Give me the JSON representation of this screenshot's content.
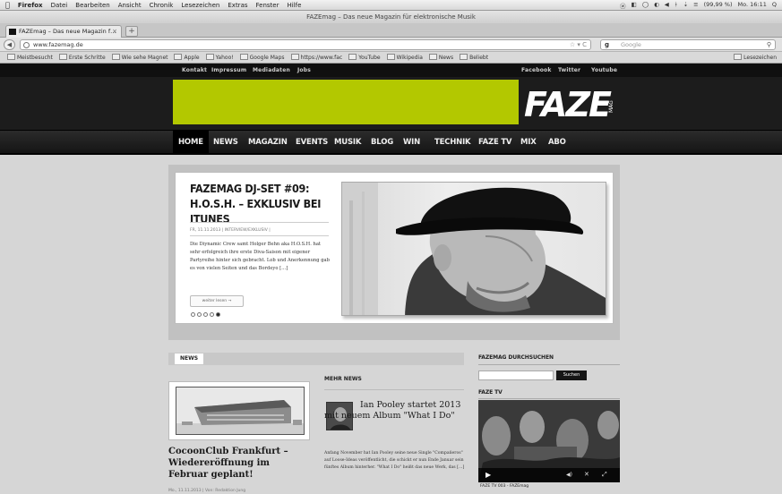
{
  "mac_menubar": {
    "apple_icon": "apple-icon",
    "menus": [
      "Firefox",
      "Datei",
      "Bearbeiten",
      "Ansicht",
      "Chronik",
      "Lesezeichen",
      "Extras",
      "Fenster",
      "Hilfe"
    ],
    "right_items": [
      "ⓦ",
      "◧",
      "◯",
      "◐",
      "◀",
      "ᚼ",
      "⇣",
      "≡",
      "(99,99 %)",
      "Mo. 16:11",
      "Q"
    ]
  },
  "browser": {
    "window_title": "FAZEmag – Das neue Magazin für elektronische Musik",
    "tab_label": "FAZEmag – Das neue Magazin f…",
    "new_tab_label": "+",
    "url": "www.fazemag.de",
    "search_engine": "Google",
    "search_placeholder": "Google",
    "bookmarks": [
      "Meistbesucht",
      "Erste Schritte",
      "Wie sehe Magnet",
      "Apple",
      "Yahoo!",
      "Google Maps",
      "https://www.fac",
      "YouTube",
      "Wikipedia",
      "News",
      "Beliebt"
    ],
    "bookmarks_right": "Lesezeichen"
  },
  "site": {
    "topstrip_left": [
      "Kontakt",
      "Impressum",
      "Mediadaten",
      "Jobs"
    ],
    "topstrip_right": [
      "Facebook",
      "Twitter",
      "Youtube"
    ],
    "banner_color": "#b3c800",
    "logo_text": "FAZE",
    "logo_small": "MAG",
    "nav": [
      "Home",
      "News",
      "Magazin",
      "Events",
      "Musik",
      "Blog",
      "Win",
      "Technik",
      "FAZE TV",
      "Mix",
      "Abo"
    ],
    "slider": {
      "title": "FAZEMAG DJ-SET #09: H.O.S.H. – EXKLUSIV BEI ITUNES",
      "meta": "FR, 11.11.2013 | INTERVIEW/EXKLUSIV | ",
      "body": "Die Diynamic Crew samt Holger Behn aka H.O.S.H. hat sehr erfolgreich ihre erste Diva-Saison mit eigener Partyreihe hinter sich gebracht. Lob und Anerkennung gab es von vielen Seiten und das Bordeyo […]",
      "read_more": "weiter lesen →",
      "dots": [
        false,
        false,
        false,
        false,
        true
      ]
    },
    "news_label": "NEWS",
    "card": {
      "title": "CocoonClub Frankfurt – Wiedereröffnung im Februar geplant!",
      "meta": "Mo., 11.11.2013 | Von: Redaktion Jung"
    },
    "mehr_news": {
      "heading": "MEHR NEWS",
      "title": "Ian Pooley startet 2013 mit neuem Album \"What I Do\"",
      "body": "Anfang November hat Ian Pooley seine neue Single \"Compañeros\" auf Loose-Ideas veröffentlicht, die schickt er nun Ende Januar sein fünftes Album hinterher. \"What I Do\" heißt das neue Werk, das […]"
    },
    "sidebar": {
      "search_heading": "FAZEMAG DURCHSUCHEN",
      "search_button": "Suchen",
      "tv_heading": "FAZE TV",
      "video_caption": "FAZE TV 003 - FAZEmag"
    }
  }
}
